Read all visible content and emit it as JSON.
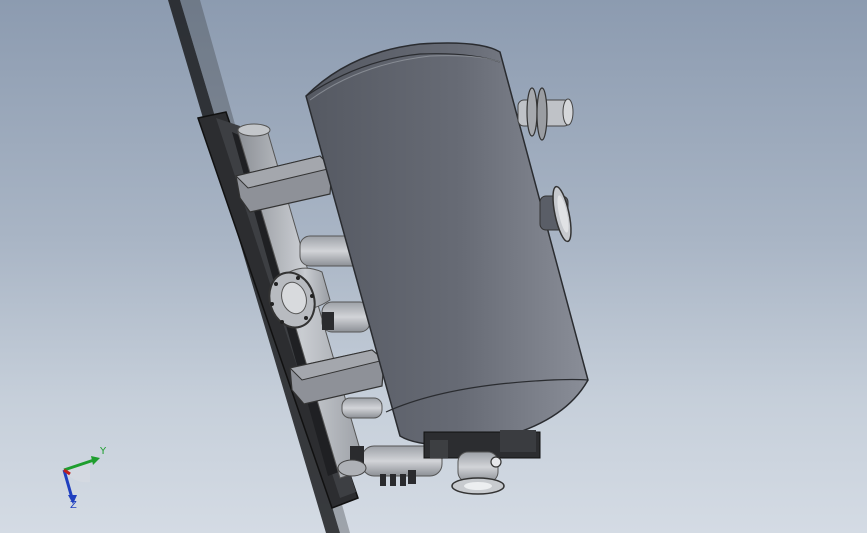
{
  "viewport": {
    "background_top": "#8c9bb0",
    "background_bottom": "#d4dbe4"
  },
  "model": {
    "vessel_color": "#646872",
    "pipe_color": "#b6b9be",
    "frame_color": "#2a2b2d",
    "bracket_color": "#8e9198"
  },
  "triad": {
    "y_label": "Y",
    "z_label": "Z",
    "y_color": "#1e9e2e",
    "z_color": "#1f3fbf",
    "x_color": "#c02020"
  }
}
